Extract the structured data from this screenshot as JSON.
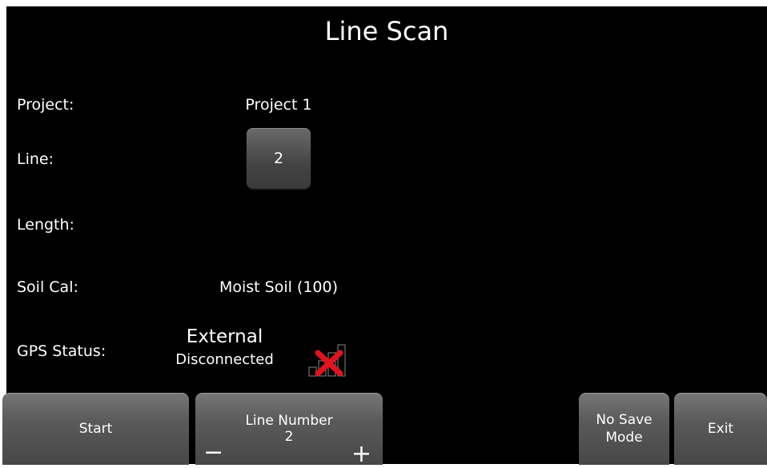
{
  "screen": {
    "title": "Line Scan"
  },
  "fields": {
    "project_label": "Project:",
    "project_value": "Project 1",
    "line_label": "Line:",
    "line_value": "2",
    "length_label": "Length:",
    "length_value": "",
    "soil_label": "Soil Cal:",
    "soil_value": "Moist Soil (100)",
    "gps_label": "GPS Status:",
    "gps_source": "External",
    "gps_state": "Disconnected"
  },
  "gps_icon": {
    "name": "gps-signal-disconnected-icon",
    "x_color": "#e0141e"
  },
  "buttons": {
    "start": "Start",
    "line_number_label": "Line Number",
    "line_number_value": "2",
    "minus": "−",
    "plus": "+",
    "no_save_line1": "No Save",
    "no_save_line2": "Mode",
    "exit": "Exit"
  }
}
